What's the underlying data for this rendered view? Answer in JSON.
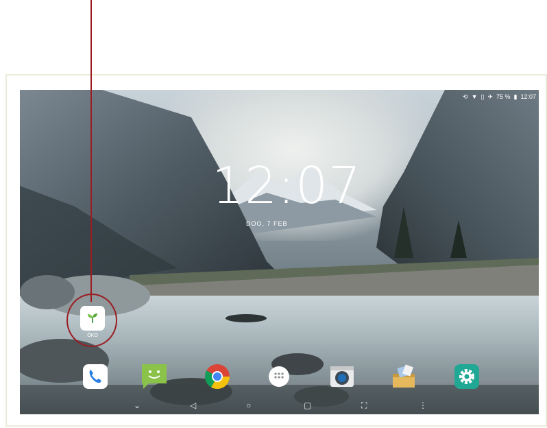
{
  "status_bar": {
    "battery": "75 %",
    "time": "12:07",
    "icons": [
      "rotation-lock-icon",
      "wifi-icon",
      "no-sim-icon",
      "airplane-icon",
      "battery-icon"
    ]
  },
  "lockscreen": {
    "clock": "12:07",
    "date": "DOO, 7 FEB"
  },
  "app_shortcut": {
    "label": "ÖKO",
    "icon": "seedling-icon"
  },
  "dock": {
    "apps": [
      {
        "icon": "phone-icon",
        "color": "#2a7de1"
      },
      {
        "icon": "messaging-icon",
        "color": "#8bc34a"
      },
      {
        "icon": "chrome-icon",
        "color": "#db4437"
      },
      {
        "icon": "app-drawer-icon",
        "color": "#ffffff"
      },
      {
        "icon": "camera-icon",
        "color": "#3d4a56"
      },
      {
        "icon": "file-manager-icon",
        "color": "#e5b85c"
      },
      {
        "icon": "settings-icon",
        "color": "#20a895"
      }
    ]
  },
  "nav_bar": {
    "buttons": [
      "collapse-icon",
      "back-icon",
      "home-icon",
      "recents-icon",
      "screenshot-icon",
      "menu-icon"
    ]
  },
  "colors": {
    "callout": "#9a1d22"
  }
}
